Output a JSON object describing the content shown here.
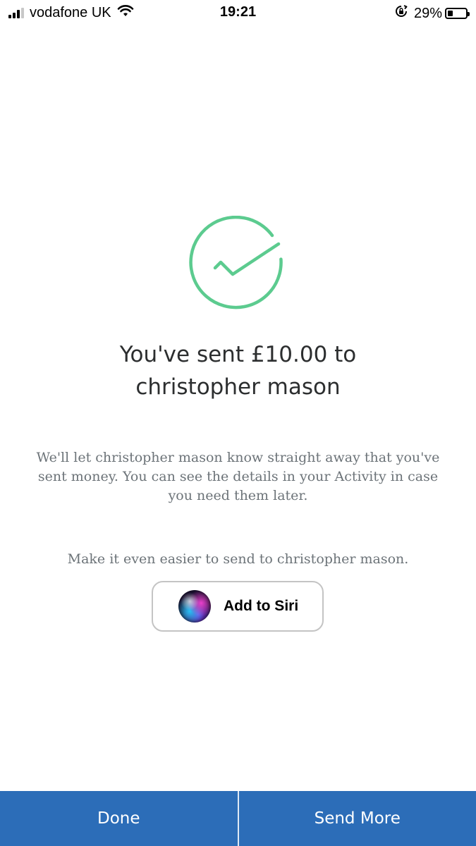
{
  "status_bar": {
    "carrier": "vodafone UK",
    "time": "19:21",
    "battery_percent": "29%",
    "battery_level": 0.29,
    "icons": [
      "signal-icon",
      "wifi-icon",
      "rotation-lock-icon",
      "battery-icon"
    ]
  },
  "confirmation": {
    "icon": "checkmark-circle-icon",
    "icon_color": "#5ccb8f",
    "headline_line1": "You've sent £10.00 to",
    "headline_line2": "christopher mason",
    "message": "We'll let christopher mason know straight away that you've sent money. You can see the details in your Activity in case you need them later."
  },
  "siri": {
    "prompt": "Make it even easier to send to christopher mason.",
    "button_label": "Add to Siri",
    "icon": "siri-icon"
  },
  "actions": {
    "done_label": "Done",
    "send_more_label": "Send More",
    "bar_color": "#2c6db8"
  }
}
